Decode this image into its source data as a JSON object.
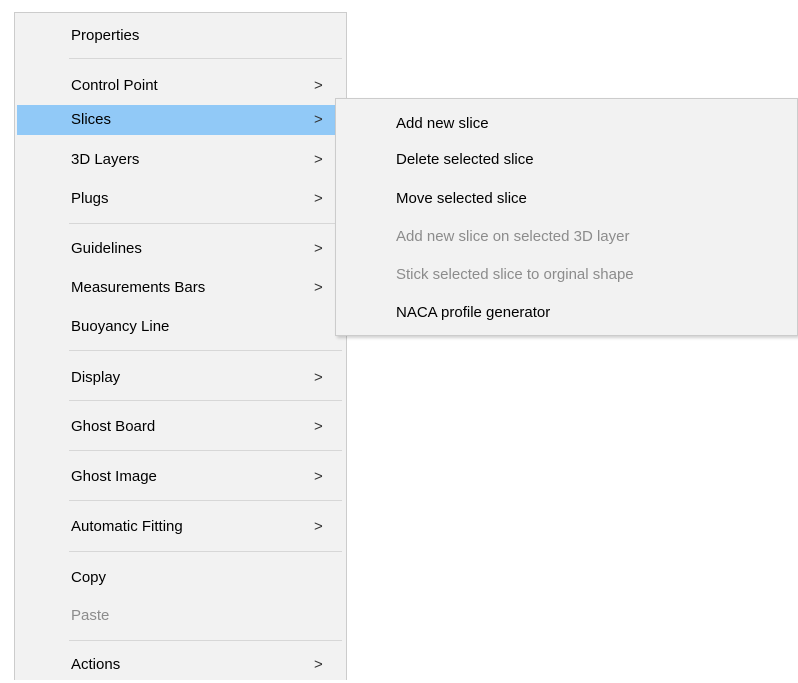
{
  "main_menu": {
    "items": [
      {
        "label": "Properties",
        "has_submenu": false
      },
      {
        "label": "Control Point",
        "has_submenu": true
      },
      {
        "label": "Slices",
        "has_submenu": true
      },
      {
        "label": "3D Layers",
        "has_submenu": true
      },
      {
        "label": "Plugs",
        "has_submenu": true
      },
      {
        "label": "Guidelines",
        "has_submenu": true
      },
      {
        "label": "Measurements Bars",
        "has_submenu": true
      },
      {
        "label": "Buoyancy Line",
        "has_submenu": false
      },
      {
        "label": "Display",
        "has_submenu": true
      },
      {
        "label": "Ghost Board",
        "has_submenu": true
      },
      {
        "label": "Ghost Image",
        "has_submenu": true
      },
      {
        "label": "Automatic Fitting",
        "has_submenu": true
      },
      {
        "label": "Copy",
        "has_submenu": false
      },
      {
        "label": "Paste",
        "has_submenu": false,
        "disabled": true
      },
      {
        "label": "Actions",
        "has_submenu": true
      }
    ],
    "highlighted_item": "Slices",
    "arrow_glyph": ">"
  },
  "slices_submenu": {
    "items": [
      {
        "label": "Add new slice",
        "disabled": false
      },
      {
        "label": "Delete selected slice",
        "disabled": false
      },
      {
        "label": "Move selected slice",
        "disabled": false
      },
      {
        "label": "Add new slice on selected 3D layer",
        "disabled": true
      },
      {
        "label": "Stick selected slice to orginal shape",
        "disabled": true
      },
      {
        "label": "NACA profile generator",
        "disabled": false
      }
    ]
  },
  "colors": {
    "menu_background": "#f2f2f2",
    "highlight": "#91c9f7",
    "disabled_text": "#8c8c8c",
    "separator": "#d7d7d7"
  }
}
